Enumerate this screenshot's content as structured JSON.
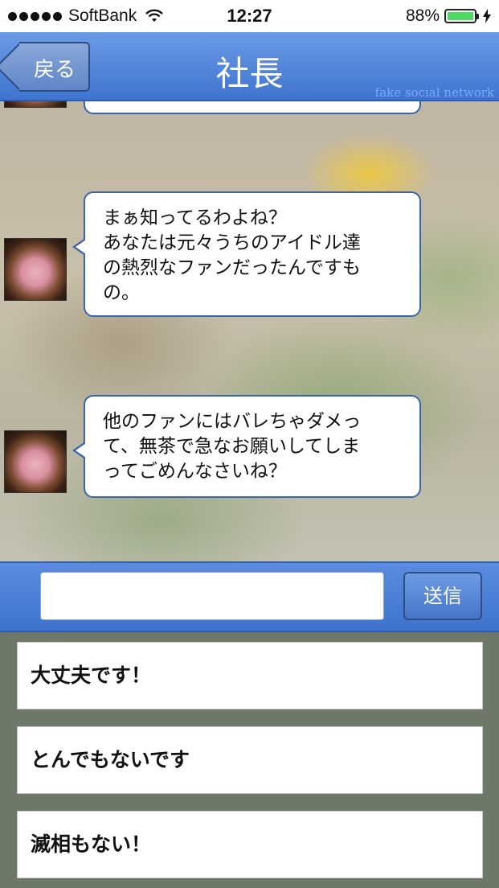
{
  "status_bar": {
    "carrier": "SoftBank",
    "time": "12:27",
    "battery": "88%",
    "battery_level": 0.88,
    "icons": [
      "signal-dots-icon",
      "wifi-icon",
      "battery-icon",
      "charging-bolt-icon"
    ]
  },
  "nav": {
    "back_label": "戻る",
    "title": "社長",
    "watermark": "fake social network"
  },
  "messages": [
    {
      "lines": [
        "まぁ知ってるわよね？",
        "あなたは元々うちのアイドル達",
        "の熱烈なファンだったんですも",
        "の。"
      ]
    },
    {
      "lines": [
        "他のファンにはバレちゃダメっ",
        "て、無茶で急なお願いしてしま",
        "ってごめんなさいね？"
      ]
    }
  ],
  "input": {
    "placeholder": "",
    "value": "",
    "send_label": "送信"
  },
  "options": [
    {
      "label": "大丈夫です！"
    },
    {
      "label": "とんでもないです"
    },
    {
      "label": "滅相もない！"
    }
  ],
  "colors": {
    "nav_blue": "#3f74cf",
    "bubble_border": "#3b63a8",
    "options_bg": "#6d7868",
    "battery_green": "#4cd964"
  }
}
